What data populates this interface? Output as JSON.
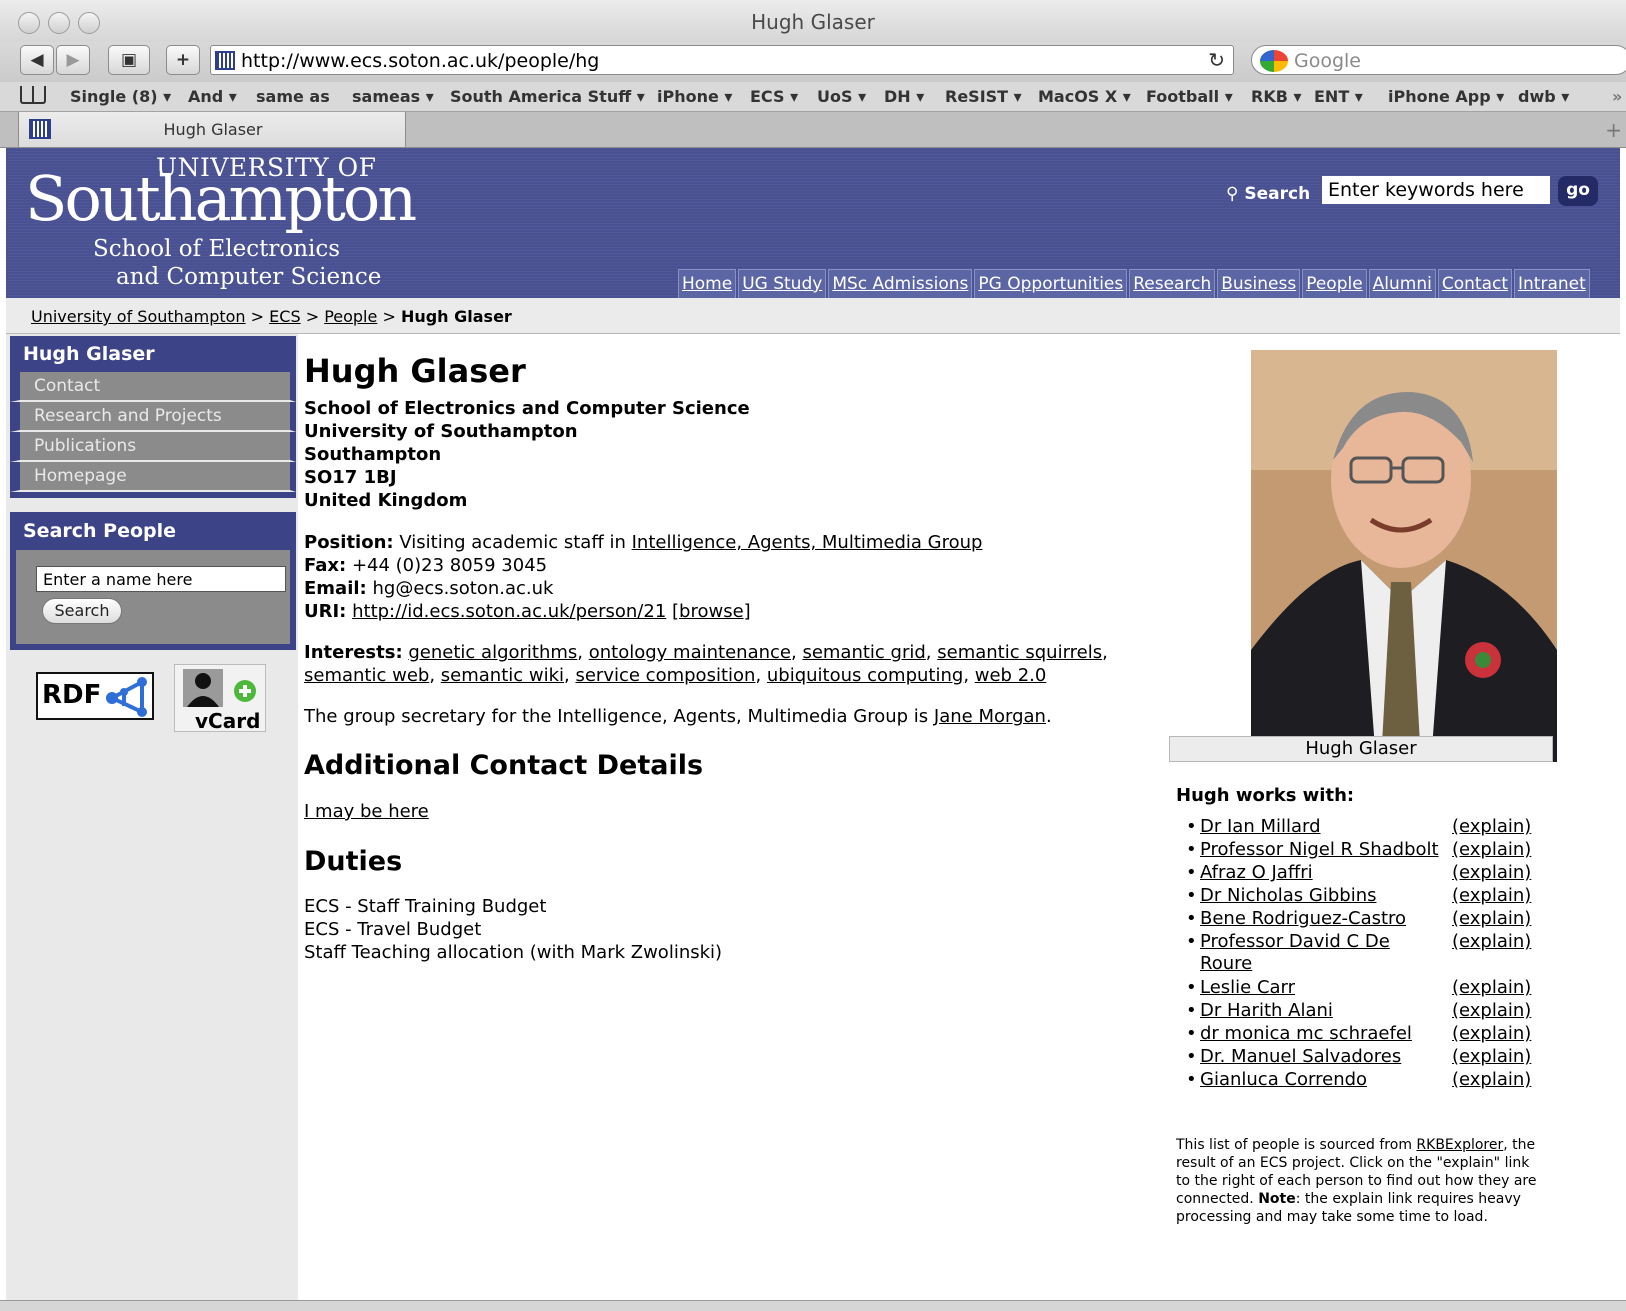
{
  "browser": {
    "window_title": "Hugh Glaser",
    "url": "http://www.ecs.soton.ac.uk/people/hg",
    "search_placeholder": "Google",
    "bookmarks": [
      "Single (8) ▾",
      "And ▾",
      "same as",
      "sameas ▾",
      "South America Stuff ▾",
      "iPhone ▾",
      "ECS ▾",
      "UoS ▾",
      "DH ▾",
      "ReSIST ▾",
      "MacOS X ▾",
      "Football ▾",
      "RKB ▾",
      "ENT ▾",
      "iPhone App ▾",
      "dwb ▾",
      "»"
    ],
    "tab_title": "Hugh Glaser"
  },
  "header": {
    "logo_line1": "UNIVERSITY OF",
    "logo_line2": "Southampton",
    "school_line1": "School of Electronics",
    "school_line2": "and Computer Science",
    "search_label": "Search",
    "search_value": "Enter keywords here",
    "go_label": "go",
    "nav": [
      "Home",
      "UG Study",
      "MSc Admissions",
      "PG Opportunities",
      "Research",
      "Business",
      "People",
      "Alumni",
      "Contact",
      "Intranet"
    ]
  },
  "breadcrumb": {
    "items": [
      "University of Southampton",
      "ECS",
      "People"
    ],
    "separator": ">",
    "current": "Hugh Glaser"
  },
  "sidebar": {
    "person_heading": "Hugh Glaser",
    "links": [
      "Contact",
      "Research and Projects",
      "Publications",
      "Homepage"
    ],
    "search_heading": "Search People",
    "search_value": "Enter a name here",
    "search_button": "Search",
    "rdf_label": "RDF",
    "vcard_label": "vCard"
  },
  "profile": {
    "name": "Hugh Glaser",
    "address": [
      "School of Electronics and Computer Science",
      "University of Southampton",
      "Southampton",
      "SO17 1BJ",
      "United Kingdom"
    ],
    "position_label": "Position:",
    "position_text": "Visiting academic staff in",
    "position_group": "Intelligence, Agents, Multimedia Group",
    "fax_label": "Fax:",
    "fax": "+44 (0)23 8059 3045",
    "email_label": "Email:",
    "email": "hg@ecs.soton.ac.uk",
    "uri_label": "URI:",
    "uri": "http://id.ecs.soton.ac.uk/person/21",
    "browse": "[browse]",
    "interests_label": "Interests:",
    "interests": [
      "genetic algorithms",
      "ontology maintenance",
      "semantic grid",
      "semantic squirrels",
      "semantic web",
      "semantic wiki",
      "service composition",
      "ubiquitous computing",
      "web 2.0"
    ],
    "secretary_text": "The group secretary for the Intelligence, Agents, Multimedia Group is",
    "secretary_name": "Jane Morgan",
    "additional_heading": "Additional Contact Details",
    "additional_link": "I may be here",
    "duties_heading": "Duties",
    "duties": [
      "ECS - Staff Training Budget",
      "ECS - Travel Budget",
      "Staff Teaching allocation (with Mark Zwolinski)"
    ]
  },
  "right": {
    "photo_caption": "Hugh Glaser",
    "works_heading": "Hugh works with:",
    "explain_label": "(explain)",
    "coworkers": [
      "Dr Ian Millard",
      "Professor Nigel R Shadbolt",
      "Afraz O Jaffri",
      "Dr Nicholas Gibbins",
      "Bene Rodriguez-Castro",
      "Professor David C De Roure",
      "Leslie Carr",
      "Dr Harith Alani",
      "dr monica mc schraefel",
      "Dr. Manuel Salvadores",
      "Gianluca Correndo"
    ],
    "note_part1": "This list of people is sourced from",
    "note_link": "RKBExplorer",
    "note_part2": ", the result of an ECS project. Click on the \"explain\" link to the right of each person to find out how they are connected.",
    "note_bold": "Note",
    "note_part3": ": the explain link requires heavy processing and may take some time to load."
  }
}
